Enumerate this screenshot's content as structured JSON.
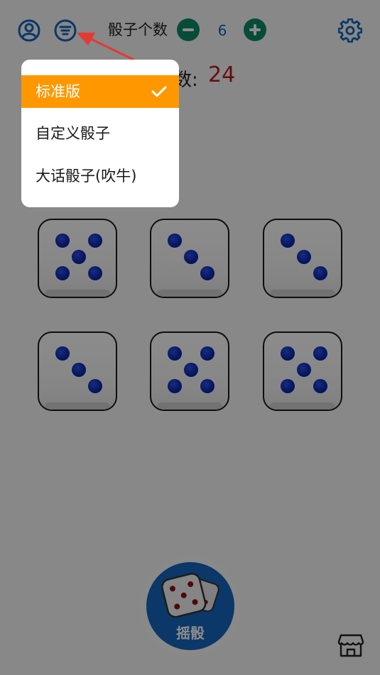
{
  "header": {
    "title": "骰子个数",
    "dice_count": "6"
  },
  "total": {
    "label_fragment": "数:",
    "value": "24"
  },
  "menu": {
    "items": [
      {
        "label": "标准版",
        "selected": true
      },
      {
        "label": "自定义骰子",
        "selected": false
      },
      {
        "label": "大话骰子(吹牛)",
        "selected": false
      }
    ]
  },
  "dice_values": [
    5,
    3,
    3,
    3,
    5,
    5
  ],
  "roll_button": {
    "label": "摇骰"
  },
  "icons": {
    "user": "user-icon",
    "filter": "filter-icon",
    "settings": "gear-icon",
    "minus": "minus-icon",
    "plus": "plus-icon",
    "shop": "store-icon",
    "check": "check-icon",
    "arrow": "arrow-icon"
  },
  "colors": {
    "accent_blue": "#1565c0",
    "accent_green": "#0b8a68",
    "menu_selected": "#ff9800",
    "total_red": "#b71c1c",
    "arrow_red": "#e53935"
  }
}
